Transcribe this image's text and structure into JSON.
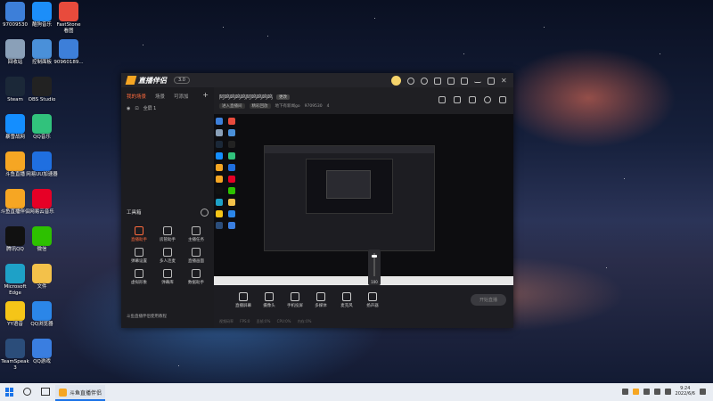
{
  "desktop": {
    "icons_left": [
      {
        "label": "97009530",
        "icon": "user-folder-icon",
        "color": "#3d7fd9"
      },
      {
        "label": "回收站",
        "icon": "recycle-bin-icon",
        "color": "#8aa0b8"
      },
      {
        "label": "Steam",
        "icon": "steam-icon",
        "color": "#1b2838"
      },
      {
        "label": "暴雪战网",
        "icon": "battlenet-icon",
        "color": "#148eff"
      },
      {
        "label": "斗鱼直播",
        "icon": "douyu-icon",
        "color": "#f6a623"
      },
      {
        "label": "斗鱼直播伴侣",
        "icon": "douyu-companion-icon",
        "color": "#f6a623"
      },
      {
        "label": "腾讯QQ",
        "icon": "qq-icon",
        "color": "#111111"
      },
      {
        "label": "Microsoft\nEdge",
        "icon": "edge-icon",
        "color": "#1ea1c7"
      },
      {
        "label": "YY语音",
        "icon": "yy-icon",
        "color": "#f5c518"
      },
      {
        "label": "TeamSpeak\n3",
        "icon": "teamspeak-icon",
        "color": "#2b4d7a"
      }
    ],
    "icons_col2": [
      {
        "label": "酷狗音乐",
        "icon": "kugou-icon",
        "color": "#1c8ef9"
      },
      {
        "label": "控制面板",
        "icon": "control-panel-icon",
        "color": "#4a90d9"
      },
      {
        "label": "OBS Studio",
        "icon": "obs-icon",
        "color": "#222222"
      },
      {
        "label": "QQ音乐",
        "icon": "qq-music-icon",
        "color": "#31c27c"
      },
      {
        "label": "网易UU加速器",
        "icon": "uu-accelerator-icon",
        "color": "#1f6fe0"
      },
      {
        "label": "网易云音乐",
        "icon": "netease-music-icon",
        "color": "#e60026"
      },
      {
        "label": "微信",
        "icon": "wechat-icon",
        "color": "#2dc100"
      },
      {
        "label": "文件",
        "icon": "folder-icon",
        "color": "#f3c14a"
      },
      {
        "label": "QQ浏览器",
        "icon": "qq-browser-icon",
        "color": "#2b86e8"
      },
      {
        "label": "QQ游戏",
        "icon": "qq-game-icon",
        "color": "#3a7ee0"
      }
    ],
    "icons_col3": [
      {
        "label": "FastStone\n看图",
        "icon": "faststone-icon",
        "color": "#e84b3c"
      },
      {
        "label": "90960189...",
        "icon": "document-icon",
        "color": "#3d7fd9"
      }
    ]
  },
  "app": {
    "name": "直播伴侣",
    "version_badge": "3.0",
    "side_tabs": [
      "我的场景",
      "场景",
      "可添加"
    ],
    "scene_label": "全屏 1",
    "tools_title": "工具箱",
    "tools": [
      {
        "label": "直播助手",
        "icon": "live-assistant-icon",
        "active": true
      },
      {
        "label": "房管助手",
        "icon": "room-manager-icon",
        "active": false
      },
      {
        "label": "主播任务",
        "icon": "streamer-task-icon",
        "active": false
      },
      {
        "label": "弹幕设置",
        "icon": "danmaku-settings-icon",
        "active": false
      },
      {
        "label": "多人连麦",
        "icon": "multi-link-icon",
        "active": false
      },
      {
        "label": "直播画面",
        "icon": "live-screen-icon",
        "active": false
      },
      {
        "label": "虚拟形象",
        "icon": "avatar-icon",
        "active": false
      },
      {
        "label": "弹幕库",
        "icon": "danmaku-library-icon",
        "active": false
      },
      {
        "label": "数据助手",
        "icon": "data-assistant-icon",
        "active": false
      }
    ],
    "tip_text": "斗鱼直播伴侣使用教程",
    "room_title": "阿呜呜呜呜阿呜呜呜呜",
    "room_tag": "更改",
    "room_meta": [
      "进入直播间",
      "精彩回放",
      "地下有新闻go",
      "9709530",
      "4"
    ],
    "bottom_buttons": [
      {
        "label": "直播屏幕",
        "icon": "screen-capture-icon"
      },
      {
        "label": "摄像头",
        "icon": "camera-icon"
      },
      {
        "label": "手机投屏",
        "icon": "phone-cast-icon"
      },
      {
        "label": "多媒体",
        "icon": "media-icon"
      },
      {
        "label": "麦克风",
        "icon": "microphone-icon"
      },
      {
        "label": "扬声器",
        "icon": "speaker-icon"
      }
    ],
    "start_live": "开始直播",
    "stats": "视频码率 FPS:0 丢帧:0% CPU:0% 内存:0%",
    "slider_value": "100"
  },
  "taskbar": {
    "app_label": "斗鱼直播伴侣",
    "time": "9:24",
    "date": "2022/6/6"
  }
}
